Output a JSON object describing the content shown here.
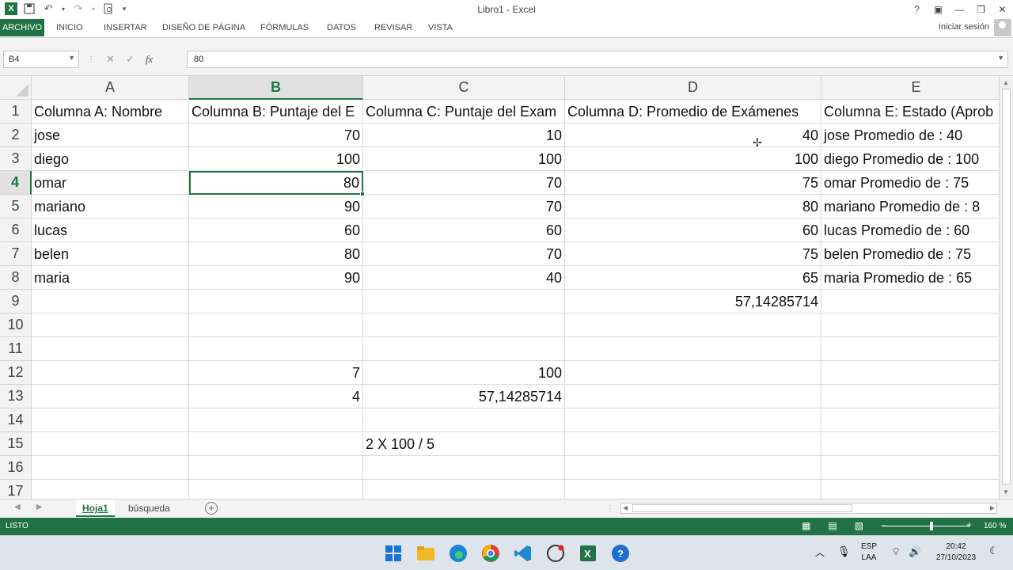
{
  "window": {
    "title": "Libro1 - Excel",
    "help": "?",
    "minimize": "—",
    "restore": "❐",
    "close": "✕"
  },
  "ribbon": {
    "file_tab": "ARCHIVO",
    "tabs": [
      "INICIO",
      "INSERTAR",
      "DISEÑO DE PÁGINA",
      "FÓRMULAS",
      "DATOS",
      "REVISAR",
      "VISTA"
    ],
    "signin": "Iniciar sesión"
  },
  "formula_bar": {
    "name_box": "B4",
    "value": "80"
  },
  "columns": [
    "A",
    "B",
    "C",
    "D",
    "E"
  ],
  "rows": [
    "1",
    "2",
    "3",
    "4",
    "5",
    "6",
    "7",
    "8",
    "9",
    "10",
    "11",
    "12",
    "13",
    "14",
    "15",
    "16",
    "17"
  ],
  "cells": {
    "A1": "Columna A: Nombre",
    "B1": "Columna B: Puntaje del E",
    "C1": "Columna C: Puntaje del Exam",
    "D1": "Columna D: Promedio de Exámenes",
    "E1": "Columna E: Estado (Aprob",
    "A2": "jose",
    "B2": "70",
    "C2": "10",
    "D2": "40",
    "E2": "jose Promedio de :  40",
    "A3": "diego",
    "B3": "100",
    "C3": "100",
    "D3": "100",
    "E3": "diego Promedio de :  100",
    "A4": "omar",
    "B4": "80",
    "C4": "70",
    "D4": "75",
    "E4": "omar Promedio de :  75",
    "A5": "mariano",
    "B5": "90",
    "C5": "70",
    "D5": "80",
    "E5": "mariano Promedio de :  8",
    "A6": "lucas",
    "B6": "60",
    "C6": "60",
    "D6": "60",
    "E6": "lucas Promedio de :  60",
    "A7": "belen",
    "B7": "80",
    "C7": "70",
    "D7": "75",
    "E7": "belen Promedio de :  75",
    "A8": "maria",
    "B8": "90",
    "C8": "40",
    "D8": "65",
    "E8": "maria Promedio de :  65",
    "D9": "57,14285714",
    "B12": "7",
    "C12": "100",
    "B13": "4",
    "C13": "57,14285714",
    "C15": "2 X 100 / 5"
  },
  "sheets": {
    "active": "Hoja1",
    "other": "búsqueda"
  },
  "status": {
    "ready": "LISTO",
    "zoom": "160 %",
    "zoom_fraction": 0.57
  },
  "taskbar": {
    "lang_top": "ESP",
    "lang_bottom": "LAA",
    "time": "20:42",
    "date": "27/10/2023"
  },
  "colors": {
    "excel_green": "#217346"
  }
}
